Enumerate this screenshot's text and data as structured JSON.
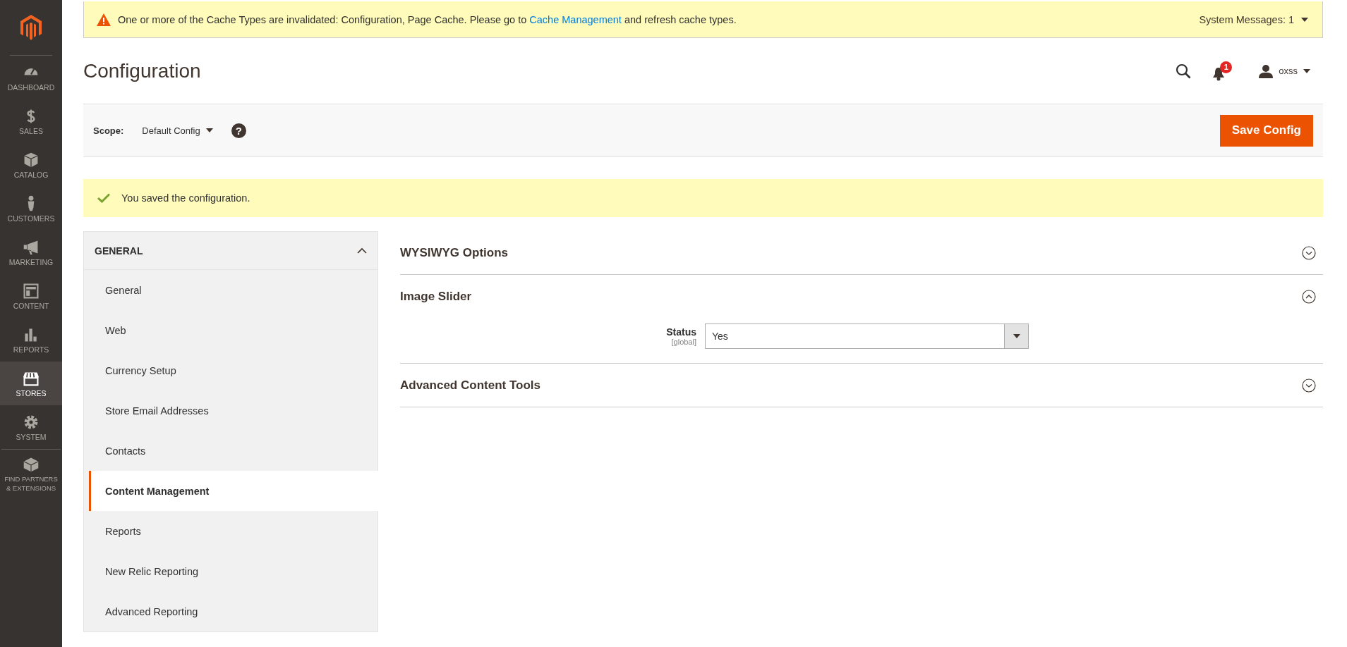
{
  "sidebar": {
    "items": [
      {
        "label": "DASHBOARD",
        "selected": false
      },
      {
        "label": "SALES",
        "selected": false
      },
      {
        "label": "CATALOG",
        "selected": false
      },
      {
        "label": "CUSTOMERS",
        "selected": false
      },
      {
        "label": "MARKETING",
        "selected": false
      },
      {
        "label": "CONTENT",
        "selected": false
      },
      {
        "label": "REPORTS",
        "selected": false
      },
      {
        "label": "STORES",
        "selected": true
      },
      {
        "label": "SYSTEM",
        "selected": false
      },
      {
        "label": "FIND PARTNERS & EXTENSIONS",
        "selected": false
      }
    ]
  },
  "system_message": {
    "text_before": "One or more of the Cache Types are invalidated: Configuration, Page Cache. Please go to ",
    "link": "Cache Management",
    "text_after": " and refresh cache types.",
    "count_label": "System Messages: 1"
  },
  "header": {
    "title": "Configuration",
    "notification_count": "1",
    "user": "oxss"
  },
  "scope_bar": {
    "label": "Scope:",
    "value": "Default Config",
    "help": "?",
    "save_button": "Save Config"
  },
  "success_message": "You saved the configuration.",
  "config_nav": {
    "group": "GENERAL",
    "expanded": true,
    "items": [
      {
        "label": "General",
        "selected": false
      },
      {
        "label": "Web",
        "selected": false
      },
      {
        "label": "Currency Setup",
        "selected": false
      },
      {
        "label": "Store Email Addresses",
        "selected": false
      },
      {
        "label": "Contacts",
        "selected": false
      },
      {
        "label": "Content Management",
        "selected": true
      },
      {
        "label": "Reports",
        "selected": false
      },
      {
        "label": "New Relic Reporting",
        "selected": false
      },
      {
        "label": "Advanced Reporting",
        "selected": false
      }
    ]
  },
  "sections": [
    {
      "title": "WYSIWYG Options",
      "expanded": false
    },
    {
      "title": "Image Slider",
      "expanded": true,
      "fields": [
        {
          "label": "Status",
          "scope": "[global]",
          "value": "Yes"
        }
      ]
    },
    {
      "title": "Advanced Content Tools",
      "expanded": false
    }
  ]
}
